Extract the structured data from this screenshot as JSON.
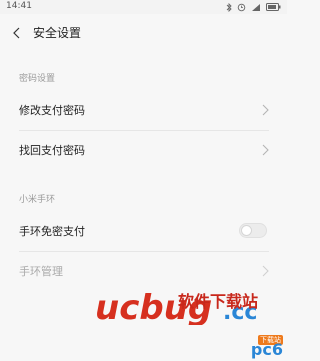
{
  "status_bar": {
    "time": "14:41",
    "icons": [
      "bluetooth-icon",
      "alarm-icon",
      "signal-icon",
      "battery-icon"
    ]
  },
  "header": {
    "title": "安全设置"
  },
  "sections": [
    {
      "label": "密码设置",
      "rows": [
        {
          "label": "修改支付密码",
          "control": "chevron"
        },
        {
          "label": "找回支付密码",
          "control": "chevron"
        }
      ]
    },
    {
      "label": "小米手环",
      "rows": [
        {
          "label": "手环免密支付",
          "control": "toggle",
          "on": false
        },
        {
          "label": "手环管理",
          "control": "chevron",
          "disabled": true
        }
      ]
    }
  ],
  "watermark": {
    "text": "软件下载站",
    "logo": "ucbug.cc",
    "site": "pc6",
    "badge": "下载站"
  },
  "colors": {
    "background": "#f7f7f7",
    "divider": "#e6e6e6",
    "section_label": "#9a9a9a",
    "watermark_red": "#c8281c",
    "watermark_blue": "#2a86d6"
  }
}
